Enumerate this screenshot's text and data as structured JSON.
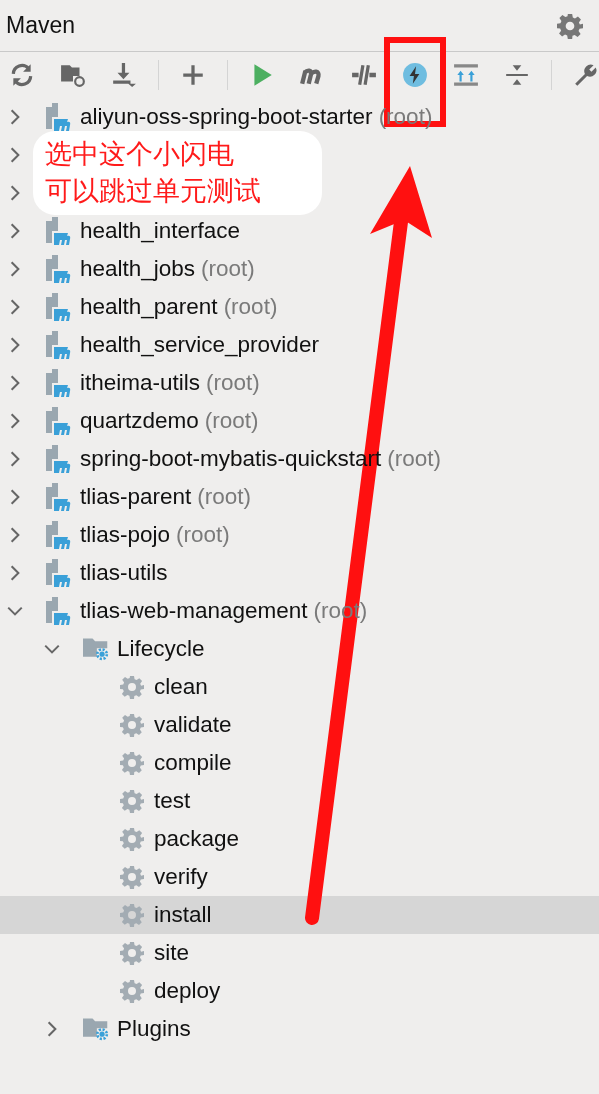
{
  "window": {
    "title": "Maven"
  },
  "callout": {
    "lines": [
      "选中这个小闪电",
      "可以跳过单元测试"
    ]
  },
  "tree": [
    {
      "name": "aliyun-oss-spring-boot-starter",
      "suffix": "(root)",
      "expanded": false
    },
    {
      "expanded": false
    },
    {
      "expanded": false
    },
    {
      "name": "health_interface",
      "expanded": false
    },
    {
      "name": "health_jobs",
      "suffix": "(root)",
      "expanded": false
    },
    {
      "name": "health_parent",
      "suffix": "(root)",
      "expanded": false
    },
    {
      "name": "health_service_provider",
      "expanded": false
    },
    {
      "name": "itheima-utils",
      "suffix": "(root)",
      "expanded": false
    },
    {
      "name": "quartzdemo",
      "suffix": "(root)",
      "expanded": false
    },
    {
      "name": "spring-boot-mybatis-quickstart",
      "suffix": "(root)",
      "expanded": false
    },
    {
      "name": "tlias-parent",
      "suffix": "(root)",
      "expanded": false
    },
    {
      "name": "tlias-pojo",
      "suffix": "(root)",
      "expanded": false
    },
    {
      "name": "tlias-utils",
      "expanded": false
    },
    {
      "name": "tlias-web-management",
      "suffix": "(root)",
      "expanded": true,
      "children": [
        {
          "name": "Lifecycle",
          "kind": "folder",
          "expanded": true,
          "children": [
            {
              "name": "clean",
              "kind": "goal",
              "selected": false
            },
            {
              "name": "validate",
              "kind": "goal",
              "selected": false
            },
            {
              "name": "compile",
              "kind": "goal",
              "selected": false
            },
            {
              "name": "test",
              "kind": "goal",
              "selected": false
            },
            {
              "name": "package",
              "kind": "goal",
              "selected": false
            },
            {
              "name": "verify",
              "kind": "goal",
              "selected": false
            },
            {
              "name": "install",
              "kind": "goal",
              "selected": true
            },
            {
              "name": "site",
              "kind": "goal",
              "selected": false
            },
            {
              "name": "deploy",
              "kind": "goal",
              "selected": false
            }
          ]
        },
        {
          "name": "Plugins",
          "kind": "folder",
          "expanded": false
        }
      ]
    }
  ]
}
